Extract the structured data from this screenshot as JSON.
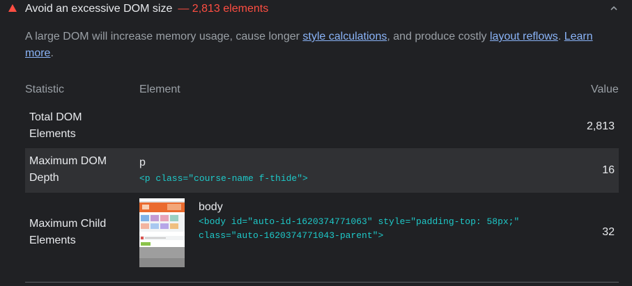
{
  "audit": {
    "title": "Avoid an excessive DOM size",
    "display_value": "— 2,813 elements",
    "description": {
      "text_1": "A large DOM will increase memory usage, cause longer ",
      "link_1": "style calculations",
      "text_2": ", and produce costly ",
      "link_2": "layout reflows",
      "text_3": ". ",
      "link_3": "Learn more",
      "text_4": "."
    },
    "table": {
      "headers": {
        "statistic": "Statistic",
        "element": "Element",
        "value": "Value"
      },
      "rows": [
        {
          "statistic": "Total DOM Elements",
          "node_label": "",
          "node_snippet": "",
          "value": "2,813"
        },
        {
          "statistic": "Maximum DOM Depth",
          "node_label": "p",
          "node_snippet": "<p class=\"course-name f-thide\">",
          "value": "16"
        },
        {
          "statistic": "Maximum Child Elements",
          "node_label": "body",
          "node_snippet_line_1": "<body id=\"auto-id-1620374771063\" style=\"padding-top: 58px;\"",
          "node_snippet_line_2": "class=\"auto-1620374771043-parent\">",
          "value": "32"
        }
      ]
    }
  },
  "colors": {
    "background": "#202124",
    "zebra_row": "#303134",
    "text_primary": "#e8eaed",
    "text_secondary": "#9aa0a6",
    "link": "#8ab4f8",
    "warning": "#ff4e42",
    "code": "#1ec9c9"
  },
  "icons": {
    "status": "warning-triangle-icon",
    "toggle": "chevron-up-icon"
  }
}
